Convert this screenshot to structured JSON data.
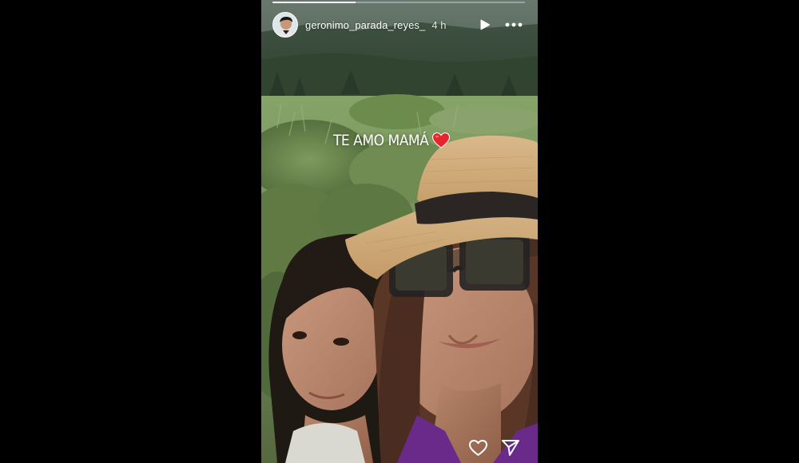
{
  "story": {
    "username": "geronimo_parada_reyes_",
    "time": "4 h",
    "progress": 0.33,
    "sticker_text": "TE AMO MAMÁ"
  },
  "icons": {
    "avatar": "profile-picture",
    "play": "play-icon",
    "more": "more-options-icon",
    "heart_sticker": "red-heart-emoji",
    "like": "heart-outline-icon",
    "share": "paper-plane-icon"
  },
  "colors": {
    "background": "#000000",
    "text": "#ffffff",
    "heart": "#e8252c"
  }
}
